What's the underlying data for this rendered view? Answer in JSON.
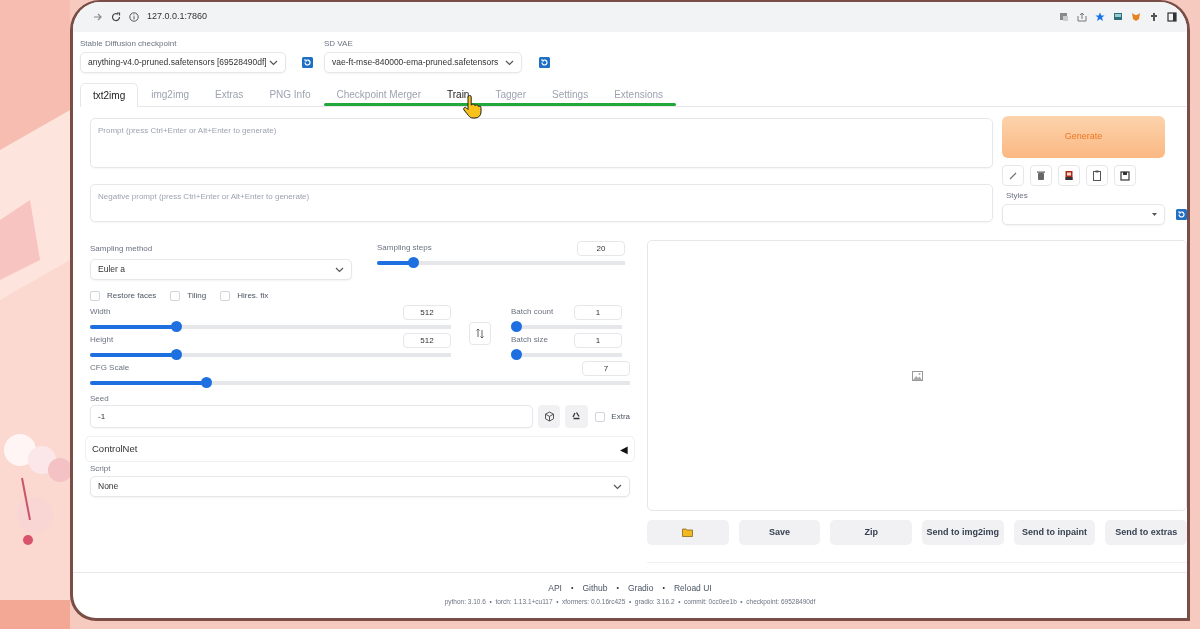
{
  "browser": {
    "url": "127.0.0.1:7860"
  },
  "checkpoint": {
    "label": "Stable Diffusion checkpoint",
    "value": "anything-v4.0-pruned.safetensors [69528490df]"
  },
  "vae": {
    "label": "SD VAE",
    "value": "vae-ft-mse-840000-ema-pruned.safetensors"
  },
  "tabs": [
    {
      "label": "txt2img",
      "selected": true,
      "hovered": false,
      "underlined": false
    },
    {
      "label": "img2img",
      "selected": false,
      "hovered": false,
      "underlined": false
    },
    {
      "label": "Extras",
      "selected": false,
      "hovered": false,
      "underlined": false
    },
    {
      "label": "PNG Info",
      "selected": false,
      "hovered": false,
      "underlined": false
    },
    {
      "label": "Checkpoint Merger",
      "selected": false,
      "hovered": false,
      "underlined": true
    },
    {
      "label": "Train",
      "selected": false,
      "hovered": true,
      "underlined": true
    },
    {
      "label": "Tagger",
      "selected": false,
      "hovered": false,
      "underlined": true
    },
    {
      "label": "Settings",
      "selected": false,
      "hovered": false,
      "underlined": true
    },
    {
      "label": "Extensions",
      "selected": false,
      "hovered": false,
      "underlined": true
    }
  ],
  "prompt": {
    "placeholder": "Prompt (press Ctrl+Enter or Alt+Enter to generate)"
  },
  "negative_prompt": {
    "placeholder": "Negative prompt (press Ctrl+Enter or Alt+Enter to generate)"
  },
  "generate_button": "Generate",
  "styles": {
    "label": "Styles"
  },
  "sampling_method": {
    "label": "Sampling method",
    "value": "Euler a"
  },
  "sampling_steps": {
    "label": "Sampling steps",
    "value": "20",
    "level": 0.13
  },
  "checkboxes": [
    {
      "label": "Restore faces",
      "checked": false
    },
    {
      "label": "Tiling",
      "checked": false
    },
    {
      "label": "Hires. fix",
      "checked": false
    }
  ],
  "width": {
    "label": "Width",
    "value": "512",
    "level": 0.23
  },
  "height": {
    "label": "Height",
    "value": "512",
    "level": 0.23
  },
  "batch_count": {
    "label": "Batch count",
    "value": "1",
    "level": 0
  },
  "batch_size": {
    "label": "Batch size",
    "value": "1",
    "level": 0
  },
  "cfg_scale": {
    "label": "CFG Scale",
    "value": "7",
    "level": 0.21
  },
  "seed": {
    "label": "Seed",
    "value": "-1"
  },
  "extra": {
    "label": "Extra",
    "checked": false
  },
  "controlnet": {
    "title": "ControlNet",
    "toggle": "◀"
  },
  "script": {
    "label": "Script",
    "value": "None"
  },
  "output_buttons": [
    {
      "kind": "folder"
    },
    {
      "kind": "text",
      "label": "Save"
    },
    {
      "kind": "text",
      "label": "Zip"
    },
    {
      "kind": "text",
      "label": "Send to img2img"
    },
    {
      "kind": "text",
      "label": "Send to inpaint"
    },
    {
      "kind": "text",
      "label": "Send to extras"
    }
  ],
  "footer": {
    "items": [
      {
        "kind": "link",
        "text": "API"
      },
      {
        "kind": "separator",
        "text": "•"
      },
      {
        "kind": "link",
        "text": "Github"
      },
      {
        "kind": "separator",
        "text": "•"
      },
      {
        "kind": "link",
        "text": "Gradio"
      },
      {
        "kind": "separator",
        "text": "•"
      },
      {
        "kind": "link",
        "text": "Reload UI"
      }
    ],
    "versions": "python: 3.10.6  •  torch: 1.13.1+cu117  •  xformers: 0.0.16rc425  •  gradio: 3.16.2  •  commit: 0cc0ee1b  •  checkpoint: 69528490df"
  }
}
